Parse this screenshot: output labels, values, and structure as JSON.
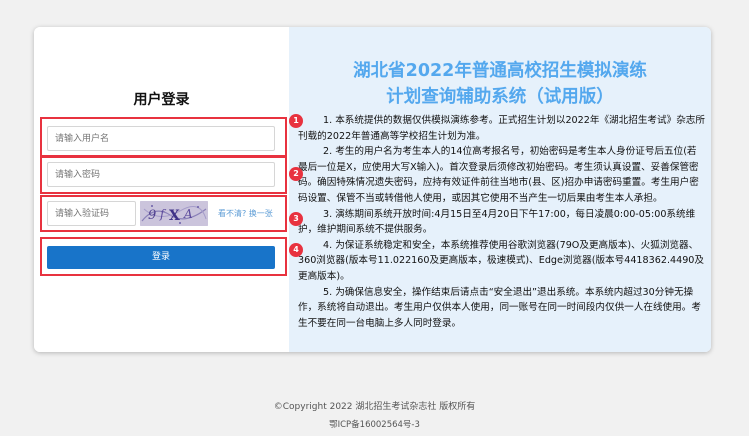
{
  "login": {
    "title": "用户登录",
    "username_placeholder": "请输入用户名",
    "password_placeholder": "请输入密码",
    "captcha_placeholder": "请输入验证码",
    "captcha_refresh": "看不清? 换一张",
    "submit_label": "登录"
  },
  "badges": [
    "1",
    "2",
    "3",
    "4"
  ],
  "notice": {
    "title_line1": "湖北省2022年普通高校招生模拟演练",
    "title_line2": "计划查询辅助系统（试用版）",
    "items": [
      "1. 本系统提供的数据仅供模拟演练参考。正式招生计划以2022年《湖北招生考试》杂志所刊载的2022年普通高等学校招生计划为准。",
      "2. 考生的用户名为考生本人的14位高考报名号，初始密码是考生本人身份证号后五位(若最后一位是X，应使用大写X输入)。首次登录后须修改初始密码。考生须认真设置、妥善保管密码。确因特殊情况遗失密码，应持有效证件前往当地市(县、区)招办申请密码重置。考生用户密码设置、保管不当或转借他人使用，或因其它使用不当产生一切后果由考生本人承担。",
      "3. 演练期间系统开放时间:4月15日至4月20日下午17:00，每日凌晨0:00-05:00系统维护，维护期间系统不提供服务。",
      "4. 为保证系统稳定和安全，本系统推荐使用谷歌浏览器(79O及更高版本)、火狐浏览器、360浏览器(版本号11.022160及更高版本，极速模式)、Edge浏览器(版本号4418362.4490及更高版本)。",
      "5. 为确保信息安全，操作结束后请点击“安全退出”退出系统。本系统内超过30分钟无操作，系统将自动退出。考生用户仅供本人使用，同一账号在同一时间段内仅供一人在线使用。考生不要在同一台电脑上多人同时登录。"
    ]
  },
  "footer": {
    "copyright": "©Copyright  2022  湖北招生考试杂志社  版权所有",
    "icp": "鄂ICP备16002564号-3"
  },
  "colors": {
    "accent_blue": "#1874c9",
    "title_blue": "#54a8ee",
    "annotation_red": "#e8323f",
    "notice_bg": "#e6f1fb"
  }
}
